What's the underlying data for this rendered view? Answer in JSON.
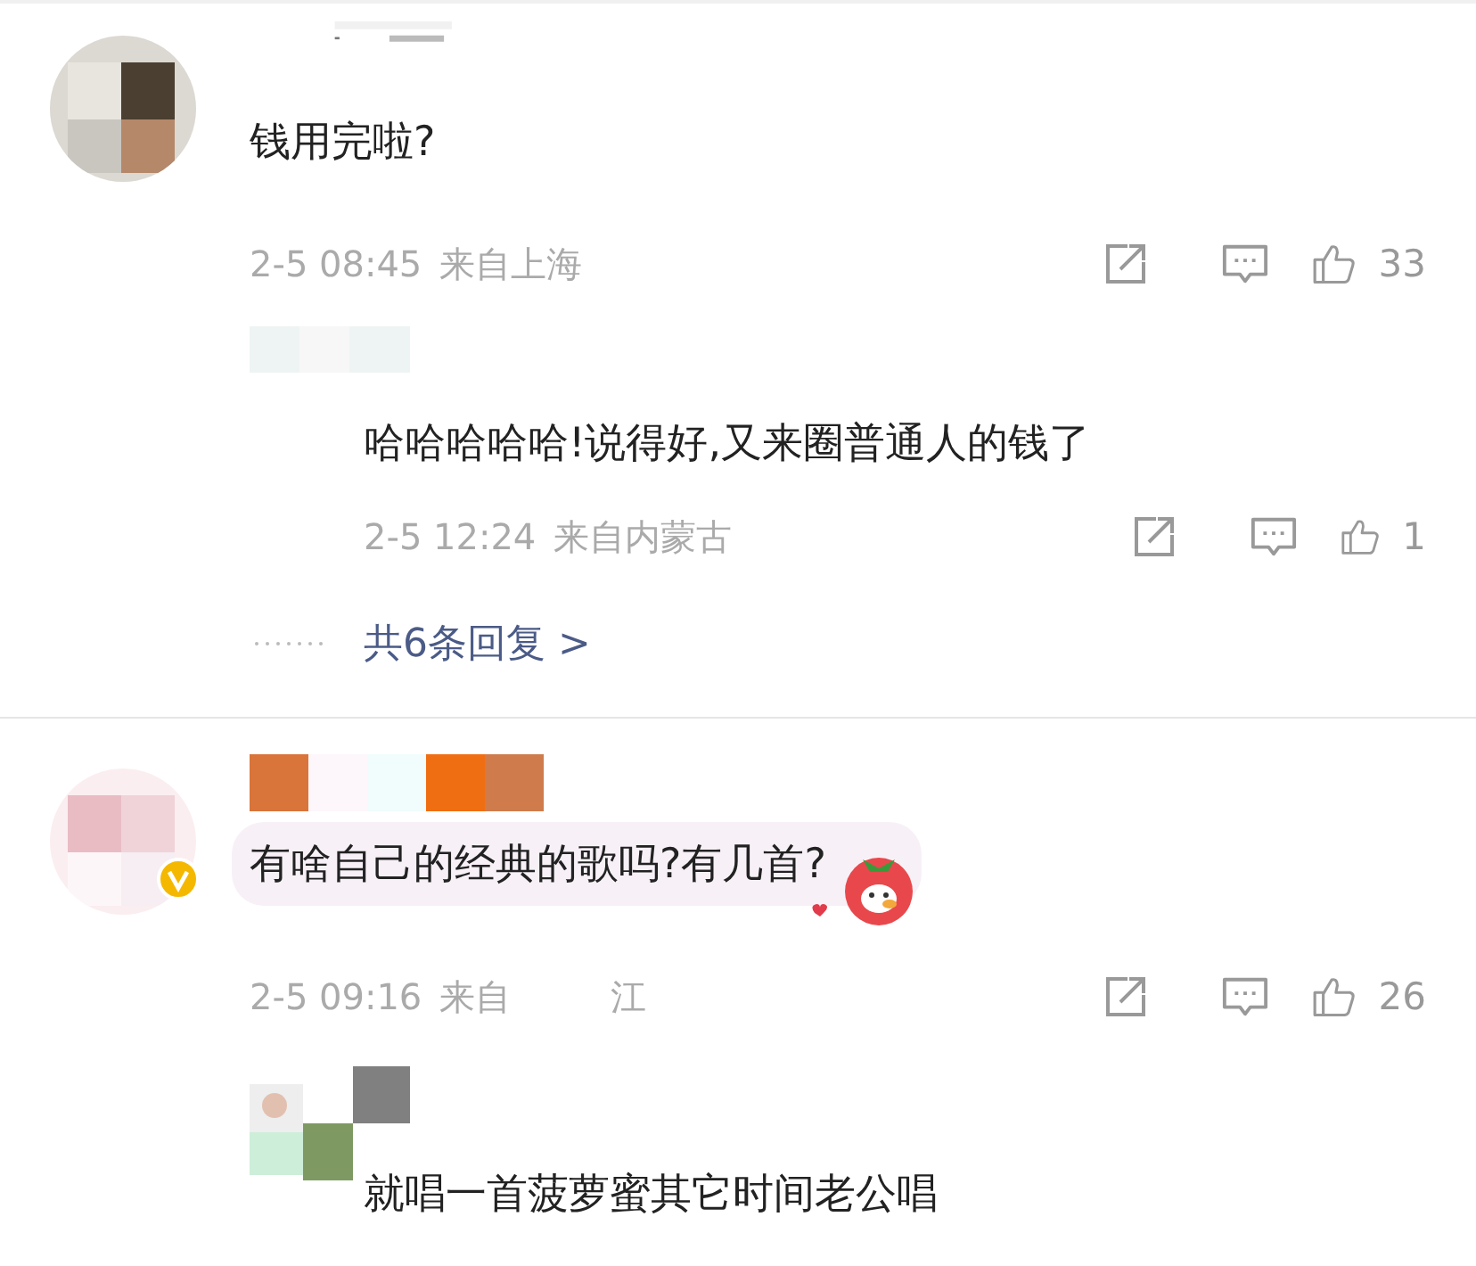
{
  "comments": [
    {
      "verified": false,
      "decorated": false,
      "text": "钱用完啦?",
      "time": "2-5 08:45",
      "location": "来自上海",
      "likes": "33",
      "replies": [
        {
          "text": "哈哈哈哈哈!说得好,又来圈普通人的钱了",
          "time": "2-5 12:24",
          "location": "来自内蒙古",
          "likes": "1"
        }
      ],
      "more_replies": "共6条回复 >"
    },
    {
      "verified": true,
      "decorated": true,
      "text": "有啥自己的经典的歌吗?有几首?",
      "time": "2-5 09:16",
      "location": "来自",
      "location_end": "江",
      "likes": "26",
      "replies": [
        {
          "text": "就唱一首菠萝蜜其它时间老公唱"
        }
      ]
    }
  ]
}
